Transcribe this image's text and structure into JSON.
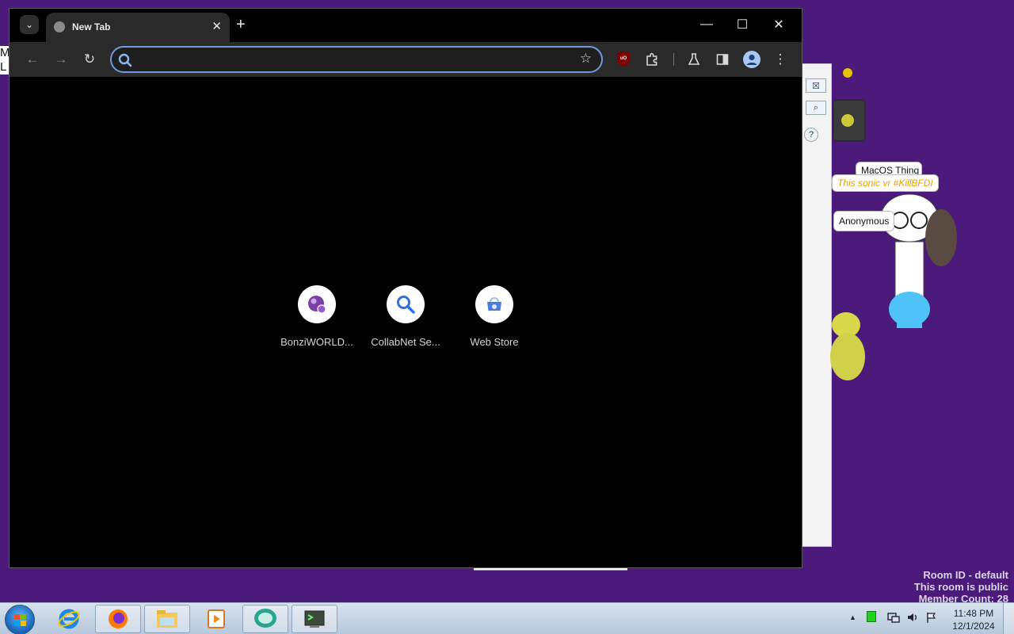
{
  "browser": {
    "tab_title": "New Tab",
    "tab_close_glyph": "✕",
    "new_tab_glyph": "+",
    "tab_search_glyph": "⌄",
    "window_controls": {
      "minimize": "—",
      "maximize": "☐",
      "close": "✕"
    },
    "toolbar": {
      "back": "←",
      "forward": "→",
      "reload": "↻",
      "star": "☆",
      "ublock_label": "uO",
      "menu": "⋮"
    },
    "omnibox": {
      "value": "",
      "placeholder": ""
    },
    "shortcuts": [
      {
        "label": "BonziWORLD...",
        "icon": "purple-globe-icon"
      },
      {
        "label": "CollabNet Se...",
        "icon": "magnifier-icon"
      },
      {
        "label": "Web Store",
        "icon": "web-store-icon"
      }
    ],
    "accent_color": "#6f9bdc"
  },
  "desktop": {
    "edge_text": "M\nL",
    "bubbles": {
      "macos": "MacOS Thing",
      "sonic": "This sonic vr #KillBFDI",
      "anonymous": "Anonymous"
    },
    "room_info": [
      "Room ID - default",
      "This room is public",
      "Member Count: 28"
    ],
    "bg_window_buttons": [
      "☒",
      "⌕",
      "?"
    ]
  },
  "taskbar": {
    "clock_time": "11:48 PM",
    "clock_date": "12/1/2024",
    "tray_arrow": "▲",
    "items": [
      "internet-explorer-icon",
      "firefox-icon",
      "file-explorer-icon",
      "media-player-icon",
      "chat-app-icon",
      "terminal-app-icon"
    ]
  }
}
